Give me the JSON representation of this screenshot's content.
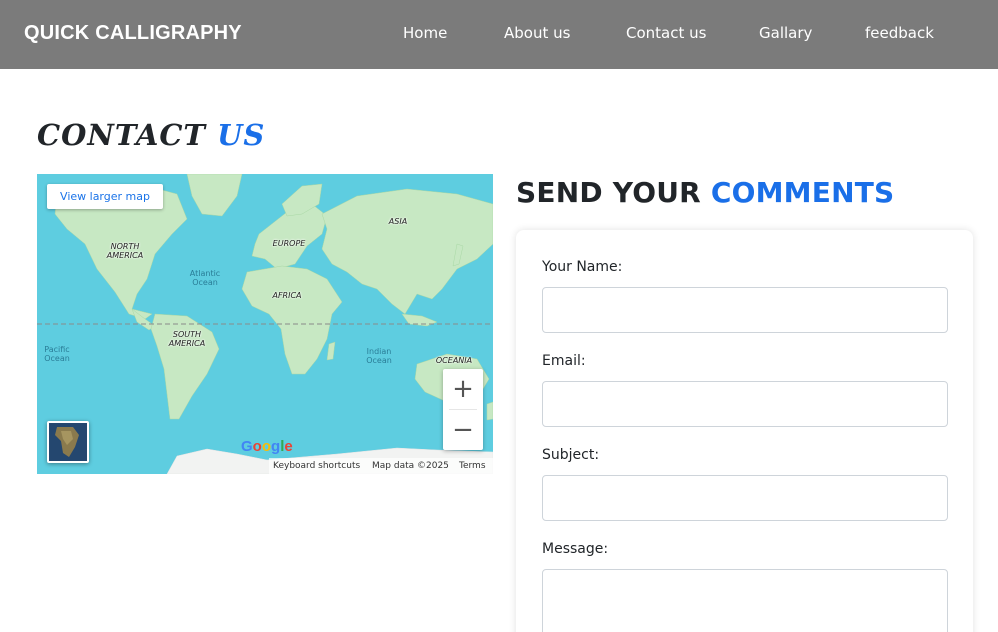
{
  "navbar": {
    "brand": "QUICK CALLIGRAPHY",
    "links": [
      "Home",
      "About us",
      "Contact us",
      "Gallary",
      "feedback"
    ],
    "background": "#7b7b7b"
  },
  "contact": {
    "title_dark": "CONTACT",
    "title_accent": "US",
    "accent_color": "#1a6fe8"
  },
  "map": {
    "view_larger": "View larger map",
    "continents": [
      "NORTH AMERICA",
      "EUROPE",
      "ASIA",
      "AFRICA",
      "SOUTH AMERICA",
      "OCEANIA"
    ],
    "oceans": [
      "Atlantic Ocean",
      "Pacific Ocean",
      "Indian Ocean"
    ],
    "zoom_in_icon": "+",
    "zoom_out_icon": "−",
    "google_logo": "Google",
    "attribution": {
      "shortcuts": "Keyboard shortcuts",
      "map_data": "Map data ©2025",
      "terms": "Terms"
    }
  },
  "comments": {
    "title_dark": "SEND YOUR",
    "title_accent": "COMMENTS"
  },
  "form": {
    "name_label": "Your Name:",
    "email_label": "Email:",
    "subject_label": "Subject:",
    "message_label": "Message:",
    "name_value": "",
    "email_value": "",
    "subject_value": "",
    "message_value": ""
  }
}
